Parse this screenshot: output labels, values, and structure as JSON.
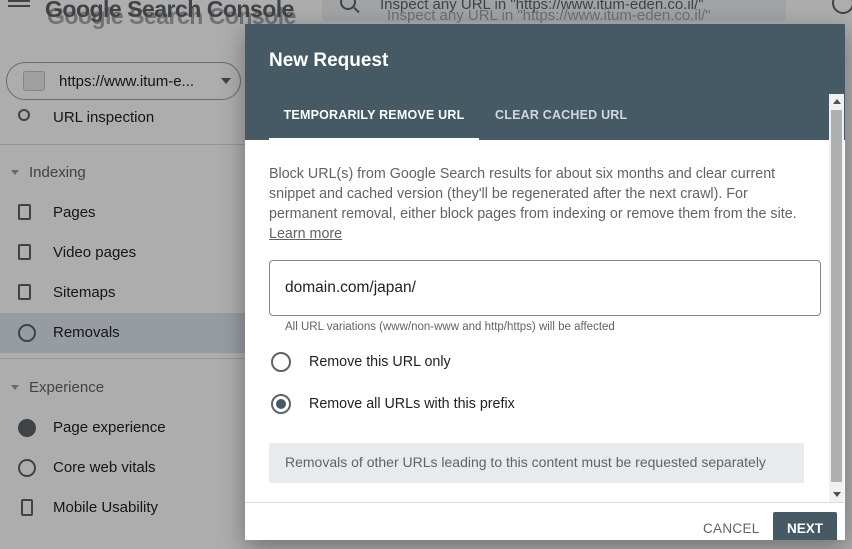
{
  "app": {
    "logo_text": "Google Search Console",
    "search_placeholder": "Inspect any URL in \"https://www.itum-eden.co.il/\"",
    "property_label": "https://www.itum-e..."
  },
  "sidebar": {
    "url_inspection": "URL inspection",
    "sections": [
      {
        "title": "Indexing",
        "items": [
          {
            "label": "Pages",
            "icon": "pages-icon"
          },
          {
            "label": "Video pages",
            "icon": "video-pages-icon"
          },
          {
            "label": "Sitemaps",
            "icon": "sitemaps-icon"
          },
          {
            "label": "Removals",
            "icon": "removals-eye-off-icon",
            "active": true
          }
        ]
      },
      {
        "title": "Experience",
        "items": [
          {
            "label": "Page experience",
            "icon": "page-experience-icon"
          },
          {
            "label": "Core web vitals",
            "icon": "core-web-vitals-icon"
          },
          {
            "label": "Mobile Usability",
            "icon": "mobile-icon"
          }
        ]
      }
    ]
  },
  "dialog": {
    "title": "New Request",
    "tabs": [
      {
        "label": "TEMPORARILY REMOVE URL",
        "active": true
      },
      {
        "label": "CLEAR CACHED URL",
        "active": false
      }
    ],
    "description": "Block URL(s) from Google Search results for about six months and clear current snippet and cached version (they'll be regenerated after the next crawl). For permanent removal, either block pages from indexing or remove them from the site.",
    "learn_more": "Learn more",
    "url_value": "domain.com/japan/",
    "url_hint": "All URL variations (www/non-www and http/https) will be affected",
    "options": [
      {
        "label": "Remove this URL only",
        "checked": false
      },
      {
        "label": "Remove all URLs with this prefix",
        "checked": true
      }
    ],
    "notice": "Removals of other URLs leading to this content must be requested separately",
    "cancel_label": "CANCEL",
    "next_label": "NEXT"
  },
  "colors": {
    "dialog_header": "#455a64",
    "active_nav": "#dfe6f1",
    "overlay": "rgba(0,0,0,0.32)"
  }
}
